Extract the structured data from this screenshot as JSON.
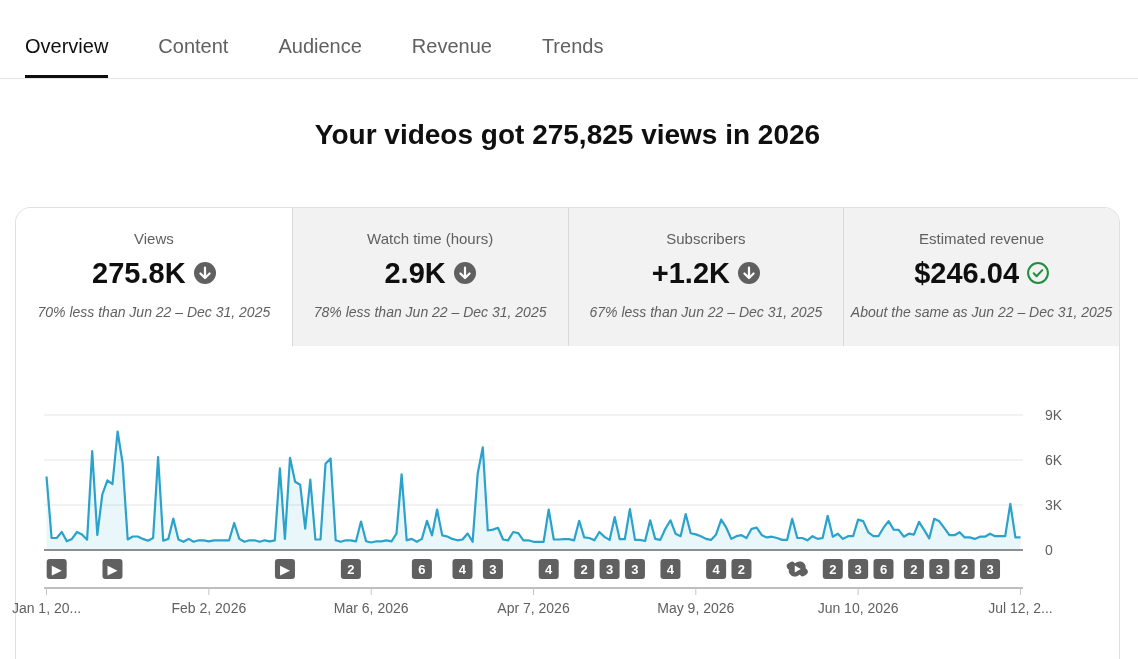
{
  "tabs": [
    {
      "label": "Overview",
      "selected": true
    },
    {
      "label": "Content",
      "selected": false
    },
    {
      "label": "Audience",
      "selected": false
    },
    {
      "label": "Revenue",
      "selected": false
    },
    {
      "label": "Trends",
      "selected": false
    }
  ],
  "headline": "Your videos got 275,825 views in 2026",
  "metrics": [
    {
      "label": "Views",
      "value": "275.8K",
      "kind": "down",
      "comparison": "70% less than Jun 22 – Dec 31, 2025",
      "selected": true
    },
    {
      "label": "Watch time (hours)",
      "value": "2.9K",
      "kind": "down",
      "comparison": "78% less than Jun 22 – Dec 31, 2025",
      "selected": false
    },
    {
      "label": "Subscribers",
      "value": "+1.2K",
      "kind": "down",
      "comparison": "67% less than Jun 22 – Dec 31, 2025",
      "selected": false
    },
    {
      "label": "Estimated revenue",
      "value": "$246.04",
      "kind": "steady",
      "comparison": "About the same as Jun 22 – Dec 31, 2025",
      "selected": false
    }
  ],
  "chart": {
    "chart_data": {
      "type": "area",
      "categories": [
        "Jan 1, 20...",
        null,
        null,
        null,
        null,
        null,
        null,
        null,
        null,
        null,
        null,
        null,
        null,
        null,
        null,
        null,
        null,
        null,
        null,
        null,
        null,
        null,
        null,
        null,
        null,
        null,
        null,
        null,
        null,
        null,
        null,
        null,
        "Feb 2, 2026",
        null,
        null,
        null,
        null,
        null,
        null,
        null,
        null,
        null,
        null,
        null,
        null,
        null,
        null,
        null,
        null,
        null,
        null,
        null,
        null,
        null,
        null,
        null,
        null,
        null,
        null,
        null,
        null,
        null,
        null,
        null,
        "Mar 6, 2026",
        null,
        null,
        null,
        null,
        null,
        null,
        null,
        null,
        null,
        null,
        null,
        null,
        null,
        null,
        null,
        null,
        null,
        null,
        null,
        null,
        null,
        null,
        null,
        null,
        null,
        null,
        null,
        null,
        null,
        null,
        null,
        "Apr 7, 2026",
        null,
        null,
        null,
        null,
        null,
        null,
        null,
        null,
        null,
        null,
        null,
        null,
        null,
        null,
        null,
        null,
        null,
        null,
        null,
        null,
        null,
        null,
        null,
        null,
        null,
        null,
        null,
        null,
        null,
        null,
        null,
        "May 9, 2026",
        null,
        null,
        null,
        null,
        null,
        null,
        null,
        null,
        null,
        null,
        null,
        null,
        null,
        null,
        null,
        null,
        null,
        null,
        null,
        null,
        null,
        null,
        null,
        null,
        null,
        null,
        null,
        null,
        null,
        null,
        null,
        "Jun 10, 2026",
        null,
        null,
        null,
        null,
        null,
        null,
        null,
        null,
        null,
        null,
        null,
        null,
        null,
        null,
        null,
        null,
        null,
        null,
        null,
        null,
        null,
        null,
        null,
        null,
        null,
        null,
        null,
        null,
        null,
        null,
        null,
        "Jul 12, 2..."
      ],
      "ylim": [
        0,
        9000
      ],
      "yticks": [
        {
          "value": 0,
          "label": "0"
        },
        {
          "value": 3000,
          "label": "3K"
        },
        {
          "value": 6000,
          "label": "6K"
        },
        {
          "value": 9000,
          "label": "9K"
        }
      ],
      "series": [
        {
          "color": "#2aa2cb",
          "values": [
            4900,
            800,
            800,
            1200,
            580,
            740,
            1200,
            1040,
            690,
            6600,
            1000,
            3700,
            4650,
            4400,
            7900,
            5800,
            700,
            900,
            900,
            740,
            620,
            800,
            6200,
            620,
            740,
            2100,
            700,
            550,
            740,
            550,
            650,
            650,
            580,
            650,
            650,
            650,
            650,
            1800,
            740,
            550,
            650,
            650,
            550,
            650,
            580,
            650,
            5450,
            740,
            6150,
            4550,
            4350,
            1430,
            4700,
            700,
            700,
            5750,
            6100,
            650,
            550,
            650,
            650,
            580,
            1900,
            580,
            500,
            580,
            580,
            650,
            580,
            1100,
            5050,
            650,
            740,
            550,
            740,
            1950,
            970,
            2700,
            970,
            900,
            740,
            650,
            700,
            1100,
            550,
            5100,
            6850,
            1300,
            1360,
            1480,
            700,
            650,
            1200,
            1130,
            650,
            650,
            550,
            550,
            550,
            2700,
            700,
            700,
            720,
            720,
            650,
            1950,
            840,
            800,
            650,
            1200,
            870,
            670,
            2200,
            720,
            720,
            2730,
            670,
            670,
            600,
            1980,
            740,
            670,
            1410,
            1980,
            1090,
            920,
            2400,
            1120,
            1040,
            920,
            740,
            670,
            1040,
            2030,
            1490,
            740,
            920,
            990,
            800,
            1410,
            1490,
            990,
            840,
            890,
            800,
            670,
            670,
            2080,
            800,
            800,
            650,
            920,
            740,
            800,
            2280,
            890,
            1090,
            740,
            920,
            920,
            2030,
            1930,
            1170,
            920,
            920,
            1490,
            1930,
            1360,
            1340,
            890,
            1090,
            1020,
            1880,
            1340,
            770,
            2080,
            1910,
            1460,
            990,
            990,
            1190,
            840,
            840,
            740,
            890,
            890,
            1090,
            920,
            920,
            920,
            3080,
            840,
            840
          ]
        }
      ],
      "annotations": [
        "▶",
        "▶",
        "▶",
        "2",
        "6",
        "4",
        "3",
        "4",
        "2",
        "3",
        "3",
        "4",
        "4",
        "2",
        "2",
        "3",
        "6",
        "2",
        "3",
        "2",
        "3"
      ]
    }
  }
}
